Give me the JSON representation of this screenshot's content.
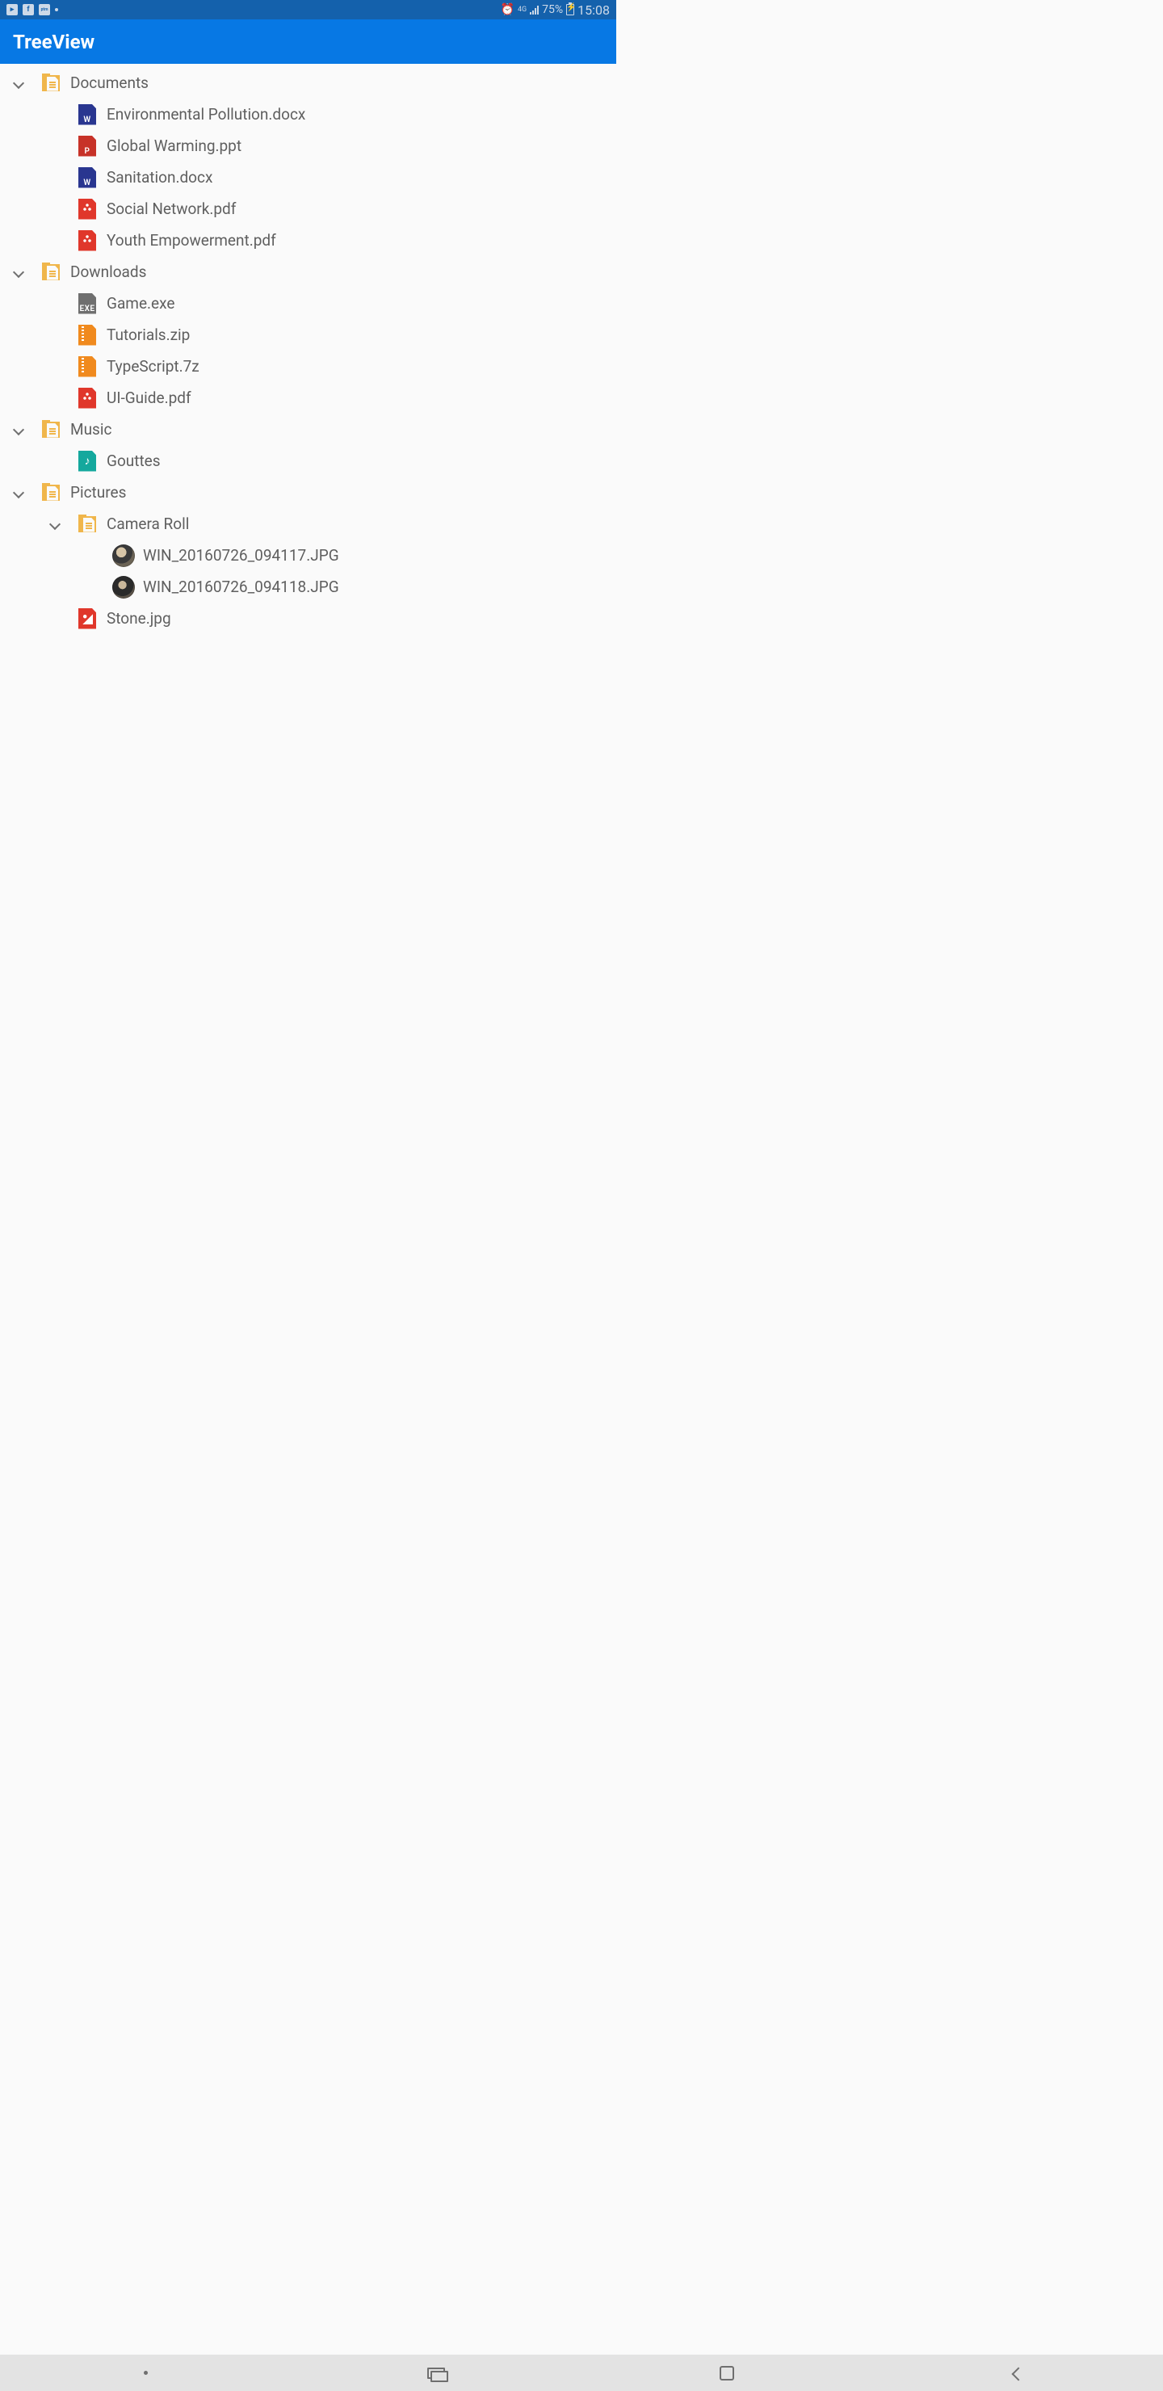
{
  "status": {
    "left_icons": [
      "video",
      "facebook",
      "paytm"
    ],
    "alarm": true,
    "network": "4G",
    "battery": "75%",
    "time": "15:08"
  },
  "app": {
    "title": "TreeView"
  },
  "tree": [
    {
      "type": "folder",
      "label": "Documents",
      "level": 0,
      "expanded": true,
      "children": [
        {
          "type": "file",
          "icon": "word",
          "label": "Environmental Pollution.docx"
        },
        {
          "type": "file",
          "icon": "ppt",
          "label": "Global Warming.ppt"
        },
        {
          "type": "file",
          "icon": "word",
          "label": "Sanitation.docx"
        },
        {
          "type": "file",
          "icon": "pdf",
          "label": "Social Network.pdf"
        },
        {
          "type": "file",
          "icon": "pdf",
          "label": "Youth Empowerment.pdf"
        }
      ]
    },
    {
      "type": "folder",
      "label": "Downloads",
      "level": 0,
      "expanded": true,
      "children": [
        {
          "type": "file",
          "icon": "exe",
          "label": "Game.exe"
        },
        {
          "type": "file",
          "icon": "zip",
          "label": "Tutorials.zip"
        },
        {
          "type": "file",
          "icon": "zip",
          "label": "TypeScript.7z"
        },
        {
          "type": "file",
          "icon": "pdf",
          "label": "UI-Guide.pdf"
        }
      ]
    },
    {
      "type": "folder",
      "label": "Music",
      "level": 0,
      "expanded": true,
      "children": [
        {
          "type": "file",
          "icon": "audio",
          "label": "Gouttes"
        }
      ]
    },
    {
      "type": "folder",
      "label": "Pictures",
      "level": 0,
      "expanded": true,
      "children": [
        {
          "type": "folder",
          "label": "Camera Roll",
          "level": 1,
          "expanded": true,
          "children": [
            {
              "type": "file",
              "icon": "thumb1",
              "label": "WIN_20160726_094117.JPG"
            },
            {
              "type": "file",
              "icon": "thumb2",
              "label": "WIN_20160726_094118.JPG"
            }
          ]
        },
        {
          "type": "file",
          "icon": "img",
          "label": "Stone.jpg"
        }
      ]
    }
  ]
}
